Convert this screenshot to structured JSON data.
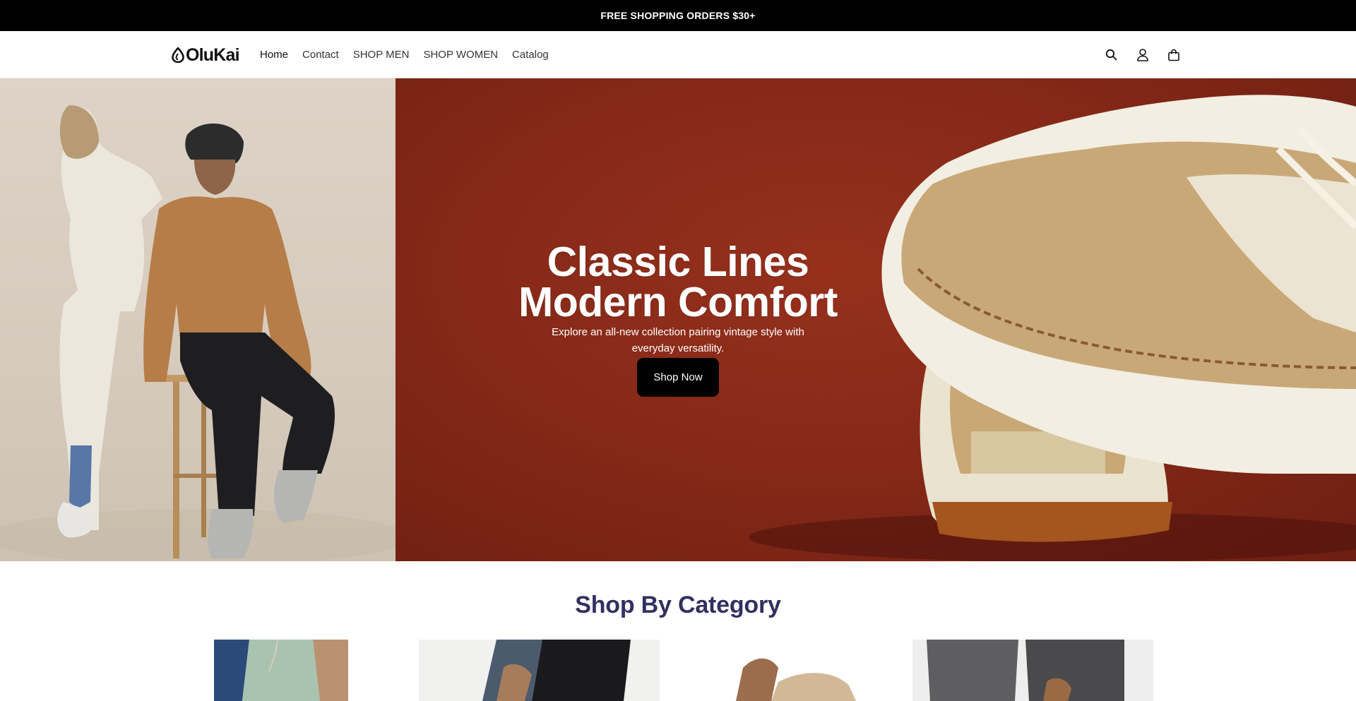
{
  "announcement": {
    "text": "FREE SHOPPING ORDERS $30+"
  },
  "header": {
    "logo_text": "OluKai",
    "nav": [
      {
        "label": "Home"
      },
      {
        "label": "Contact"
      },
      {
        "label": "SHOP MEN"
      },
      {
        "label": "SHOP WOMEN"
      },
      {
        "label": "Catalog"
      }
    ],
    "icons": [
      "search-icon",
      "account-icon",
      "cart-icon"
    ]
  },
  "hero": {
    "title_line1": "Classic Lines",
    "title_line2": "Modern Comfort",
    "subtitle": "Explore an all-new collection pairing vintage style with everyday versatility.",
    "button_label": "Shop Now",
    "colors": {
      "left_bg": "#d6cbbd",
      "right_bg": "#8a2b1b",
      "button_bg": "#000000"
    }
  },
  "categories": {
    "title": "Shop By Category",
    "title_color": "#323060"
  }
}
